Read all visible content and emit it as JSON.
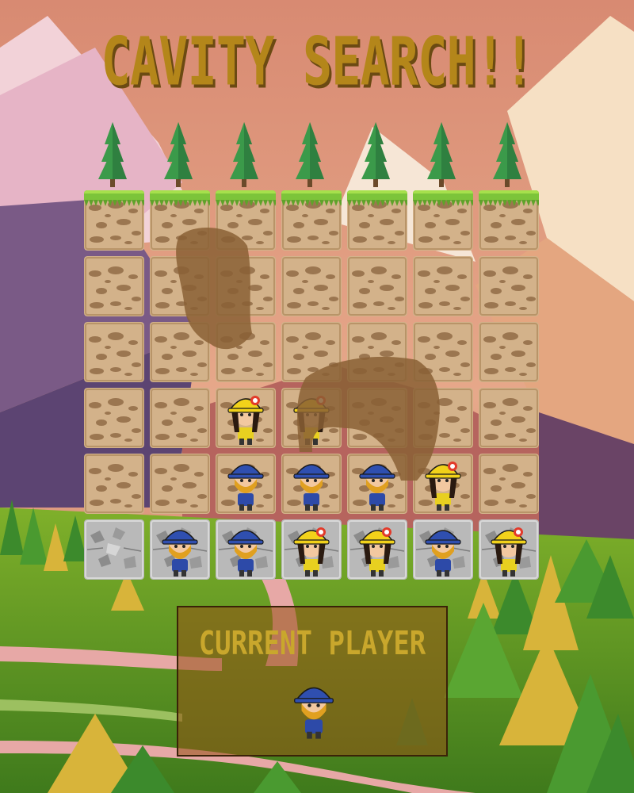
{
  "title": "CAVITY SEARCH!!",
  "current_player": {
    "label": "CURRENT PLAYER",
    "player": "blue"
  },
  "colors": {
    "title": "#b4861a",
    "dirt": "#d0b08a",
    "tunnel": "#8a6035",
    "rock": "#b8b8b8",
    "blue_helmet": "#2f4fb0",
    "yellow_helmet": "#f2d21a"
  },
  "board": {
    "columns": 7,
    "rows": 6,
    "grid": [
      [
        {
          "tile": "grass"
        },
        {
          "tile": "grass"
        },
        {
          "tile": "grass"
        },
        {
          "tile": "grass"
        },
        {
          "tile": "grass"
        },
        {
          "tile": "grass"
        },
        {
          "tile": "grass"
        }
      ],
      [
        {
          "tile": "dirt"
        },
        {
          "tile": "dirt"
        },
        {
          "tile": "dirt"
        },
        {
          "tile": "dirt"
        },
        {
          "tile": "dirt"
        },
        {
          "tile": "dirt"
        },
        {
          "tile": "dirt"
        }
      ],
      [
        {
          "tile": "dirt"
        },
        {
          "tile": "dirt"
        },
        {
          "tile": "dirt"
        },
        {
          "tile": "dirt"
        },
        {
          "tile": "dirt"
        },
        {
          "tile": "dirt"
        },
        {
          "tile": "dirt"
        }
      ],
      [
        {
          "tile": "dirt"
        },
        {
          "tile": "dirt"
        },
        {
          "tile": "dirt",
          "piece": "yellow"
        },
        {
          "tile": "dirt",
          "piece": "yellow"
        },
        {
          "tile": "dirt"
        },
        {
          "tile": "dirt"
        },
        {
          "tile": "dirt"
        }
      ],
      [
        {
          "tile": "dirt"
        },
        {
          "tile": "dirt"
        },
        {
          "tile": "dirt",
          "piece": "blue"
        },
        {
          "tile": "dirt",
          "piece": "blue"
        },
        {
          "tile": "dirt",
          "piece": "blue"
        },
        {
          "tile": "dirt",
          "piece": "yellow"
        },
        {
          "tile": "dirt"
        }
      ],
      [
        {
          "tile": "rock"
        },
        {
          "tile": "rock",
          "piece": "blue"
        },
        {
          "tile": "rock",
          "piece": "blue"
        },
        {
          "tile": "rock",
          "piece": "yellow"
        },
        {
          "tile": "rock",
          "piece": "yellow"
        },
        {
          "tile": "rock",
          "piece": "blue"
        },
        {
          "tile": "rock",
          "piece": "yellow"
        }
      ]
    ]
  }
}
